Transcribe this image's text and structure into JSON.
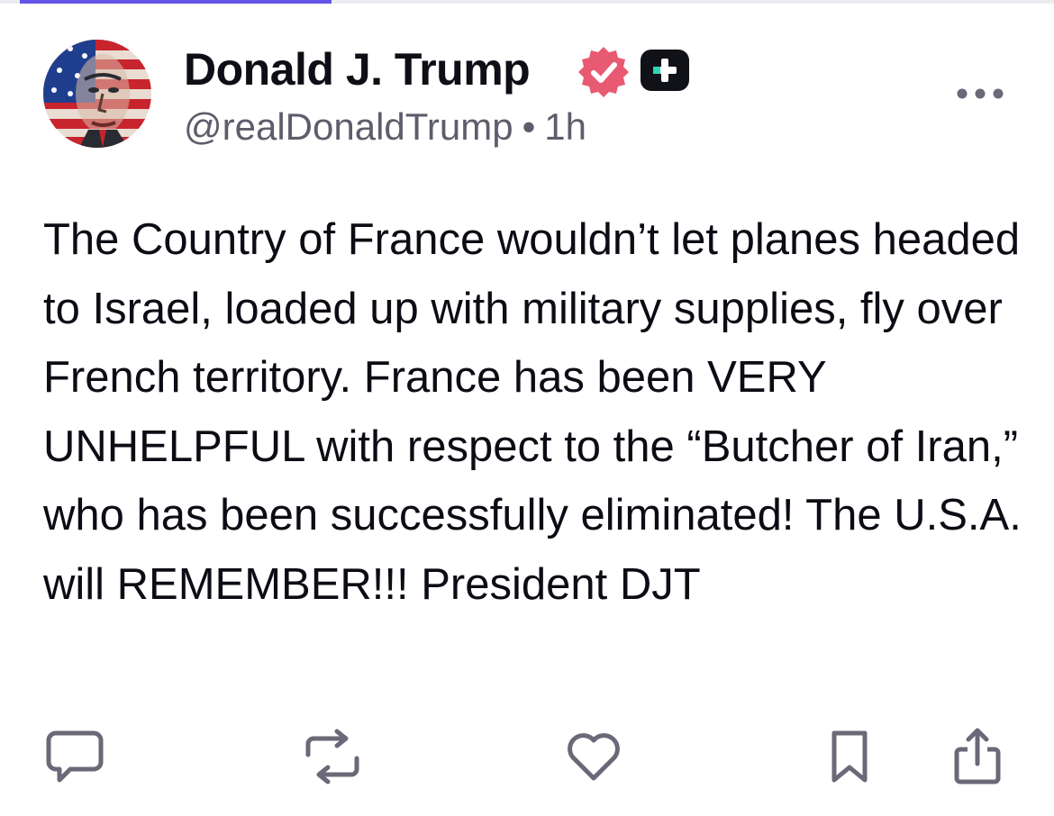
{
  "header": {
    "display_name": "Donald J. Trump",
    "handle": "@realDonaldTrump",
    "separator": "•",
    "time_ago": "1h"
  },
  "post": {
    "text": "The Country of France wouldn’t let planes headed to Israel, loaded up with military supplies, fly over French territory. France has been VERY UNHELPFUL with respect to the “Butcher of Iran,” who has been successfully eliminated! The U.S.A. will REMEMBER!!! President DJT"
  },
  "icons": {
    "avatar": "flag-portrait-avatar",
    "verified": "verified-badge-icon",
    "plus_badge": "plus-badge-icon",
    "more": "more-options-icon",
    "reply": "reply-icon",
    "repost": "repost-icon",
    "like": "heart-icon",
    "bookmark": "bookmark-icon",
    "share": "share-icon"
  },
  "colors": {
    "accent": "#6354e6",
    "verified": "#e85a72",
    "text": "#0e0e16",
    "muted": "#5f5c6b",
    "icon": "#6b6878"
  }
}
